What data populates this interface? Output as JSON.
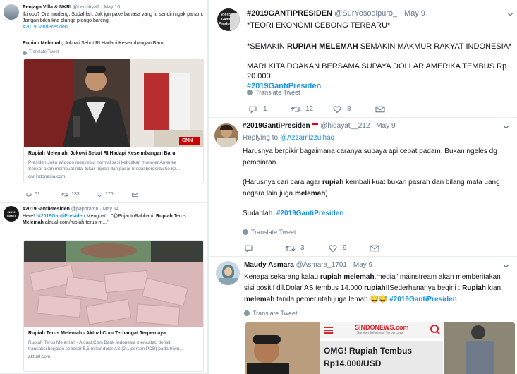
{
  "tweet_a": {
    "name": "Penjaga Villa & NKRI",
    "handle": "@herdittya1",
    "date": "May 16",
    "text_line1": "Iki opo? Ora mudeng. Sudahlah, Jok jgn pake bahasa yang lu sendiri ngak paham.",
    "text_line2": "Jangan bikin kita planga  plongo bareng.",
    "hashtag": "#2019GantiPresiden",
    "line2_prefix": "Rupiah Melemah",
    "line2_rest": ", Jokowi Sebut RI Hadapi Keseimbangan Baru",
    "translate": "Translate Tweet",
    "card_title": "Rupiah Melemah, Jokowi Sebut RI Hadapi Keseimbangan Baru",
    "card_desc1": "Presiden Joko Widodo menyebut normalisasi kebijakan moneter Amerika",
    "card_desc2": "Serikat akan membuat nilai tukar rupiah dan pasar modal bergerak ke ke...",
    "card_domain": "cnnindonesia.com",
    "cnn_logo": "CNN",
    "replies": "61",
    "retweets": "133",
    "likes": "176"
  },
  "tweet_b": {
    "name": "#2019GantiPresiden",
    "handle": "@pappramu",
    "date": "May 14",
    "avatar_text": "#2019 GANTI",
    "text_p1": "Here! ",
    "text_tag": "*#2019GantiPresiden",
    "text_p2": " Menguat... \"@PrijantoRabbani: ",
    "text_rupiah": "Rupiah",
    "text_p3": " Terus",
    "text_melemah": "Melemah",
    "text_p4": " aktual.com/rupiah-terus-m...\"",
    "card_title": "Rupiah Terus Melemah - Aktual.Com Terhangat Terpercaya",
    "card_desc1": "Rupiah Terus Melemah - Aktual.Com Bank Indonesia mencatat, defisit",
    "card_desc2": "transaksi berjalan sebesar 5,5 miliar dolar AS (2,1 persen PDB) pada triwu...",
    "card_domain": "aktual.com"
  },
  "tweet_c": {
    "name": "#2019GANTIPRESIDEN",
    "handle": "@SurYosodipuro_",
    "date": "May 9",
    "avatar_text": "#2019 Ganti Presiden",
    "line1": "*TEORI EKONOMI CEBONG TERBARU*",
    "line2_a": "*SEMAKIN ",
    "line2_b": "RUPIAH MELEMAH",
    "line2_c": " SEMAKIN MAKMUR RAKYAT INDONESIA*",
    "line3": "MARI KITA DOAKAN BERSAMA SUPAYA DOLLAR AMERIKA TEMBUS Rp 20.000",
    "hashtag": "#2019GantiPresiden",
    "translate": "Translate Tweet",
    "replies": "1",
    "retweets": "12",
    "likes": "8"
  },
  "tweet_d": {
    "name": "#2019GantiPresiden",
    "handle": "@hidayat__212",
    "date": "May 9",
    "replying_label": "Replying to ",
    "replying_to": "@Azzamizzulhaq",
    "line1": "Harusnya berpikir bagaimana caranya supaya api cepat padam. Bukan ngeles dg",
    "line2": "pembiaran.",
    "line3_a": "(Harusnya cari cara agar ",
    "line3_b": "rupiah",
    "line3_c": " kembali kuat bukan pasrah dan bilang mata uang",
    "line4_a": "negara lain juga ",
    "line4_b": "melemah",
    "line4_c": ")",
    "line5_a": "Sudahlah. ",
    "hashtag": "#2019GantiPresiden",
    "translate": "Translate Tweet",
    "retweets": "3",
    "likes": "9"
  },
  "tweet_e": {
    "name": "Maudy Asmara",
    "handle": "@Asmara_1701",
    "date": "May 9",
    "line1_a": "Kenapa sekarang kalau ",
    "line1_b": "rupiah melemah",
    "line1_c": ",media\" mainstream akan memberitakan",
    "line2_a": "sisi positif dll.Dolar AS tembus 14.000 ",
    "line2_b": "rupiah",
    "line2_c": "!!Sederhananya begini : ",
    "line2_d": "Rupiah",
    "line2_e": " kian",
    "line3_a": "melemah",
    "line3_b": " tanda pemerintah juga lemah ",
    "emoji": "😅😅",
    "hashtag": "#2019GantiPresiden",
    "translate": "Translate Tweet",
    "news_logo": "SINDONEWS.com",
    "news_sub": "Sumber Informasi Terpercaya",
    "news_head1": "OMG! Rupiah Tembus",
    "news_head2": "Rp14.000/USD"
  },
  "colors": {
    "link": "#1b95e0",
    "background": "#e6ecf0",
    "text": "#14171a",
    "muted": "#657786",
    "cnn": "#cc0000",
    "sindo_red": "#d8262c"
  }
}
